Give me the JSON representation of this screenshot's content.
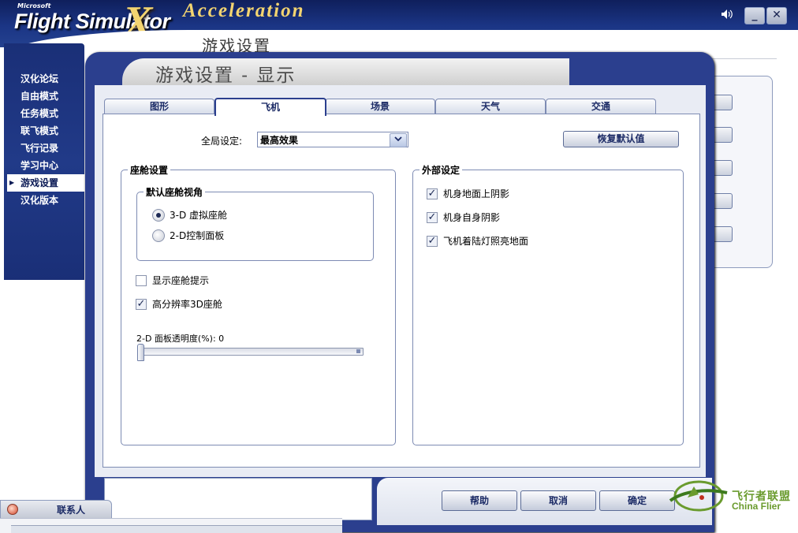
{
  "header": {
    "ms_label": "Microsoft",
    "brand": "Flight Simulator",
    "brand_x": "X",
    "subtitle": "Acceleration",
    "sound_icon": "speaker-icon",
    "minimize_label": "_",
    "close_label": "✕",
    "outer_title": "游戏设置"
  },
  "sidebar": {
    "items": [
      {
        "label": "汉化论坛",
        "active": false
      },
      {
        "label": "自由模式",
        "active": false
      },
      {
        "label": "任务模式",
        "active": false
      },
      {
        "label": "联飞模式",
        "active": false
      },
      {
        "label": "飞行记录",
        "active": false
      },
      {
        "label": "学习中心",
        "active": false
      },
      {
        "label": "游戏设置",
        "active": true
      },
      {
        "label": "汉化版本",
        "active": false
      }
    ]
  },
  "dialog": {
    "title": "游戏设置 - 显示",
    "tabs": [
      {
        "label": "图形",
        "active": false
      },
      {
        "label": "飞机",
        "active": true
      },
      {
        "label": "场景",
        "active": false
      },
      {
        "label": "天气",
        "active": false
      },
      {
        "label": "交通",
        "active": false
      }
    ],
    "global_label": "全局设定:",
    "global_value": "最高效果",
    "restore_label": "恢复默认值",
    "cockpit": {
      "title": "座舱设置",
      "view_group": "默认座舱视角",
      "radio_3d": "3-D 虚拟座舱",
      "radio_2d": "2-D控制面板",
      "selected": "3-D 虚拟座舱",
      "show_tips": "显示座舱提示",
      "show_tips_checked": false,
      "hires_3d": "高分辨率3D座舱",
      "hires_3d_checked": true,
      "slider_label": "2-D 面板透明度(%): 0",
      "slider_value": 0
    },
    "external": {
      "title": "外部设定",
      "items": [
        {
          "label": "机身地面上阴影",
          "checked": true
        },
        {
          "label": "机身自身阴影",
          "checked": true
        },
        {
          "label": "飞机着陆灯照亮地面",
          "checked": true
        }
      ]
    },
    "buttons": {
      "help": "帮助",
      "cancel": "取消",
      "ok": "确定"
    }
  },
  "footer": {
    "contacts_label": "联系人"
  },
  "watermark": {
    "cn": "飞行者联盟",
    "en": "China Flier"
  },
  "colors": {
    "navy": "#2b3f8e",
    "header": "#1b3585",
    "accent_gold": "#f3d470",
    "watermark_green": "#6a9b2e"
  }
}
